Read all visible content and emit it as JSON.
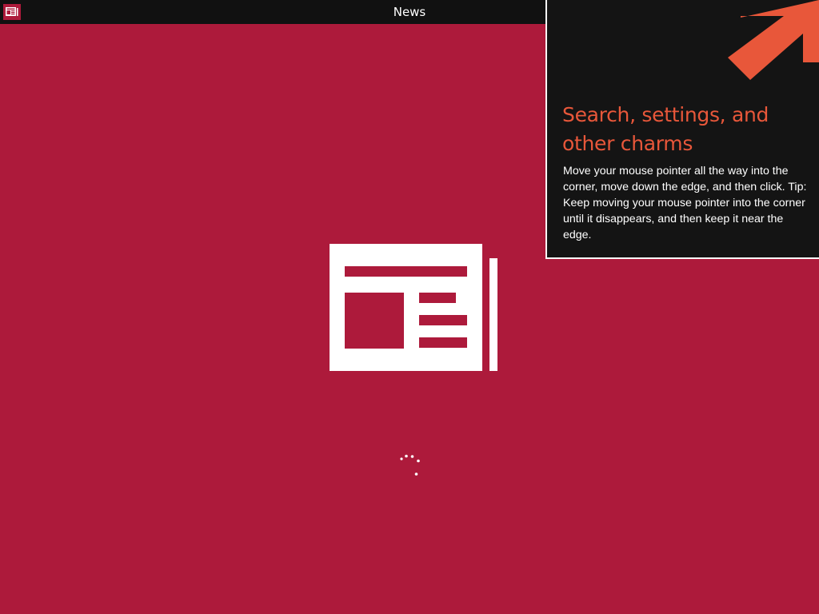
{
  "app": {
    "title": "News",
    "icon": "news-icon",
    "background_color": "#ad1a3b"
  },
  "tip": {
    "heading": "Search, settings, and other charms",
    "body": "Move your mouse pointer all the way into the corner, move down the edge, and then click. Tip: Keep moving your mouse pointer into the corner until it disappears, and then keep it near the edge.",
    "accent_color": "#e8573a",
    "arrow_icon": "arrow-up-right-icon"
  },
  "splash": {
    "logo_icon": "newspaper-icon",
    "loading_icon": "loading-spinner-icon"
  }
}
